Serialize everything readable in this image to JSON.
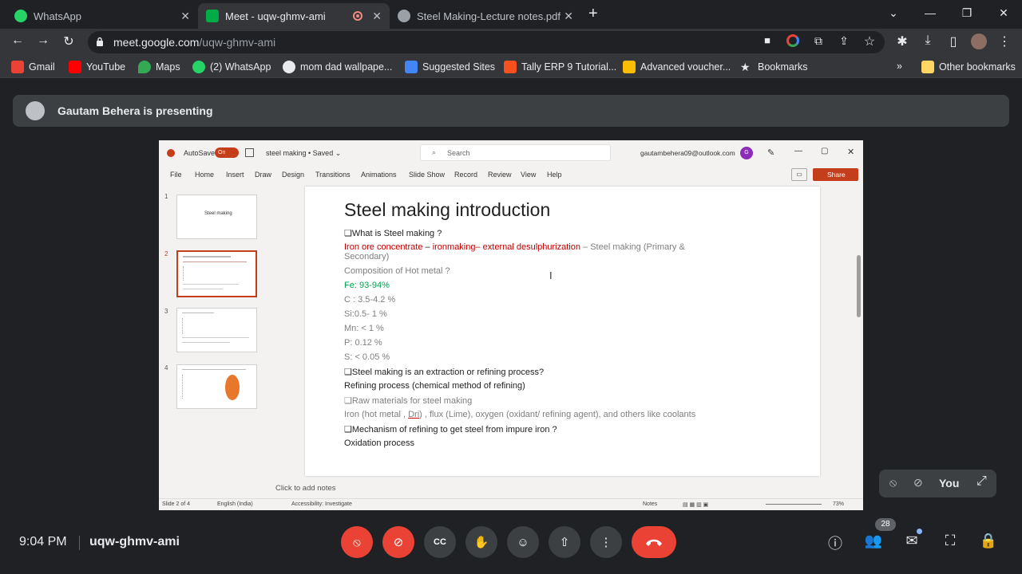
{
  "browser": {
    "tabs": [
      {
        "title": "WhatsApp"
      },
      {
        "title": "Meet - uqw-ghmv-ami"
      },
      {
        "title": "Steel Making-Lecture notes.pdf"
      }
    ],
    "url_domain": "meet.google.com",
    "url_path": "/uqw-ghmv-ami",
    "bookmarks": [
      "Gmail",
      "YouTube",
      "Maps",
      "(2) WhatsApp",
      "mom dad wallpape...",
      "Suggested Sites",
      "Tally ERP 9 Tutorial...",
      "Advanced voucher...",
      "Bookmarks"
    ],
    "other_bookmarks": "Other bookmarks",
    "overflow": "»"
  },
  "meet": {
    "presenting": "Gautam Behera is presenting",
    "time": "9:04 PM",
    "code": "uqw-ghmv-ami",
    "self_label": "You",
    "people_count": "28"
  },
  "ppt": {
    "autosave": "AutoSave",
    "autosave_state": "On",
    "doc": "steel making • Saved ⌄",
    "search": "Search",
    "account": "gautambehera09@outlook.com",
    "account_initial": "G",
    "share": "Share",
    "menu": [
      "File",
      "Home",
      "Insert",
      "Draw",
      "Design",
      "Transitions",
      "Animations",
      "Slide Show",
      "Record",
      "Review",
      "View",
      "Help"
    ],
    "thumbs": [
      "1",
      "2",
      "3",
      "4"
    ],
    "thumb1_title": "Steel making",
    "notes": "Click to add notes",
    "status_slide": "Slide 2 of 4",
    "status_lang": "English (India)",
    "status_access": "Accessibility: Investigate",
    "status_notes": "Notes",
    "zoom": "73%"
  },
  "slide": {
    "title": "Steel making introduction",
    "q1": "❑What is Steel making ?",
    "l2a": "Iron ore concentrate",
    "l2b": " – ",
    "l2c": "ironmaking– external desulphurization",
    "l2d": "  – Steel making (Primary &",
    "l2e": "Secondary)",
    "l3": "Composition of Hot metal ?",
    "fe": "Fe: 93-94%",
    "c": "C : 3.5-4.2 %",
    "si": "Si:0.5- 1 %",
    "mn": "Mn: < 1 %",
    "p": "P: 0.12 %",
    "s": "S: < 0.05 %",
    "q2": "❑Steel making is an extraction or refining process?",
    "refining": "Refining process (chemical method of refining)",
    "raw": "❑Raw materials for steel making",
    "iron_a": "Iron (hot metal , ",
    "iron_b": "Dri",
    "iron_c": ") , flux (Lime), oxygen (oxidant/ refining agent), and others like coolants",
    "q3": "❑Mechanism of refining to get steel from impure iron ?",
    "oxidation": "Oxidation process"
  }
}
